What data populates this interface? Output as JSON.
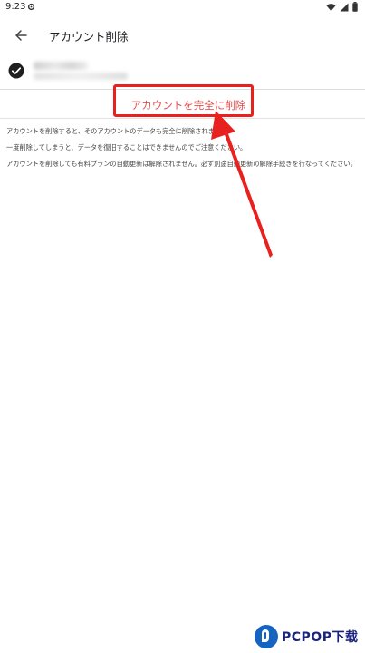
{
  "status_bar": {
    "time": "9:23",
    "icons": [
      "settings-gear-icon",
      "wifi-icon",
      "cellular-signal-icon",
      "battery-icon"
    ]
  },
  "app_bar": {
    "title": "アカウント削除",
    "back_icon": "arrow-left-icon"
  },
  "account": {
    "check_icon": "check-circle-icon"
  },
  "actions": {
    "delete_label": "アカウントを完全に削除"
  },
  "notes": [
    "アカウントを削除すると、そのアカウントのデータも完全に削除されます。",
    "一度削除してしまうと、データを復旧することはできませんのでご注意ください。",
    "アカウントを削除しても有料プランの自動更新は解除されません。必ず別途自動更新の解除手続きを行なってください。"
  ],
  "annotation": {
    "color": "#e8201e"
  },
  "watermark": {
    "text": "PCPOP下载"
  },
  "colors": {
    "accent_red": "#e24b4b",
    "text": "#202124"
  }
}
